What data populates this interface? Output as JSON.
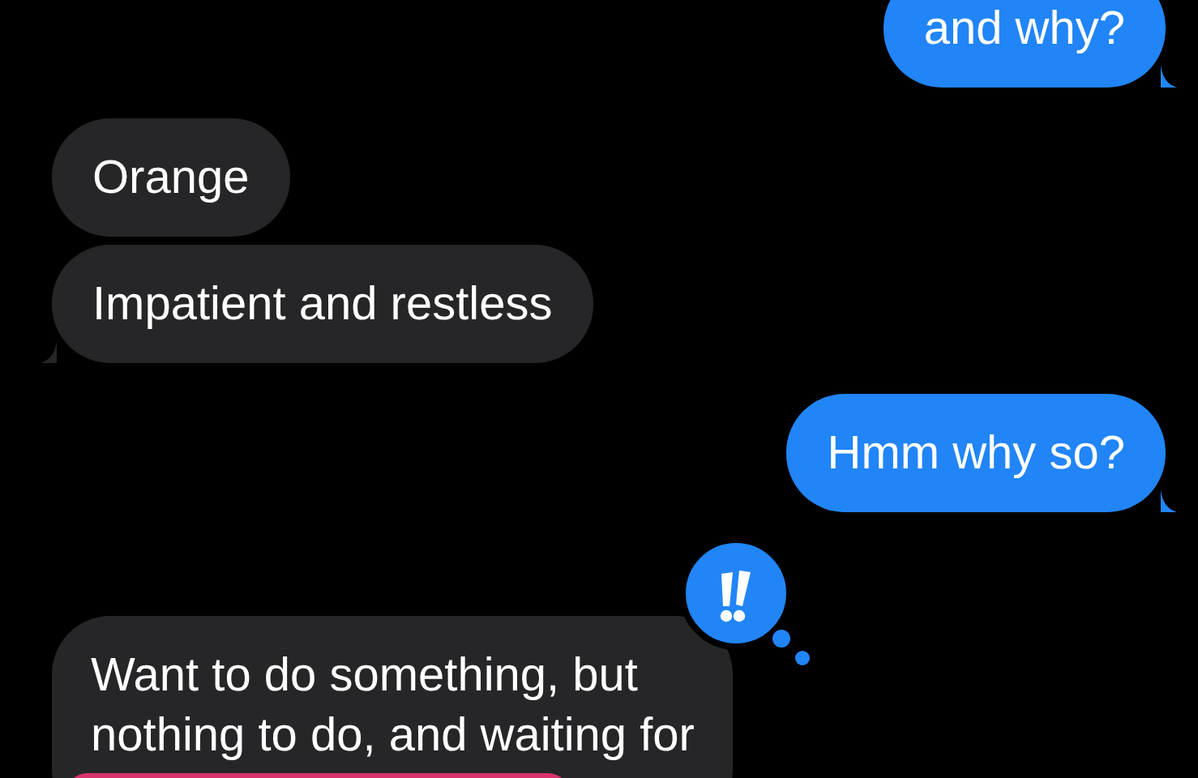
{
  "messages": [
    {
      "kind": "outgoing",
      "lines": [
        "and why?"
      ],
      "tail": true,
      "emphasized": false,
      "redaction": false
    },
    {
      "kind": "incoming",
      "lines": [
        "Orange"
      ],
      "tail": false,
      "emphasized": false,
      "redaction": false
    },
    {
      "kind": "incoming",
      "lines": [
        "Impatient and restless"
      ],
      "tail": true,
      "emphasized": false,
      "redaction": false
    },
    {
      "kind": "outgoing",
      "lines": [
        "Hmm why so?"
      ],
      "tail": true,
      "emphasized": false,
      "redaction": false
    },
    {
      "kind": "incoming",
      "lines": [
        "Want to do something, but",
        "nothing to do, and waiting for"
      ],
      "tail": false,
      "emphasized": true,
      "redaction": true
    }
  ]
}
